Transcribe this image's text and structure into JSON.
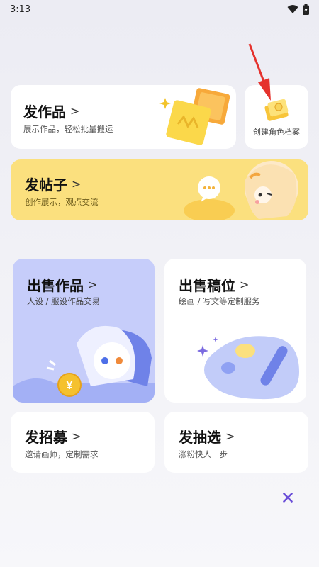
{
  "status": {
    "time": "3:13"
  },
  "cards": {
    "post_work": {
      "title": "发作品",
      "subtitle": "展示作品，轻松批量搬运"
    },
    "character": {
      "label": "创建角色档案"
    },
    "post_thread": {
      "title": "发帖子",
      "subtitle": "创作展示，观点交流"
    },
    "sell_work": {
      "title": "出售作品",
      "subtitle": "人设 / 服设作品交易"
    },
    "sell_slot": {
      "title": "出售稿位",
      "subtitle": "绘画 / 写文等定制服务"
    },
    "recruit": {
      "title": "发招募",
      "subtitle": "邀请画师，定制需求"
    },
    "lottery": {
      "title": "发抽选",
      "subtitle": "涨粉快人一步"
    }
  },
  "colors": {
    "accent_purple": "#6b4fd8",
    "thread_yellow": "#fbe080",
    "sell_blue": "#c6cdfa"
  },
  "icons": [
    "wifi-icon",
    "battery-icon",
    "chevron-right-icon",
    "close-icon",
    "red-arrow-annotation"
  ]
}
